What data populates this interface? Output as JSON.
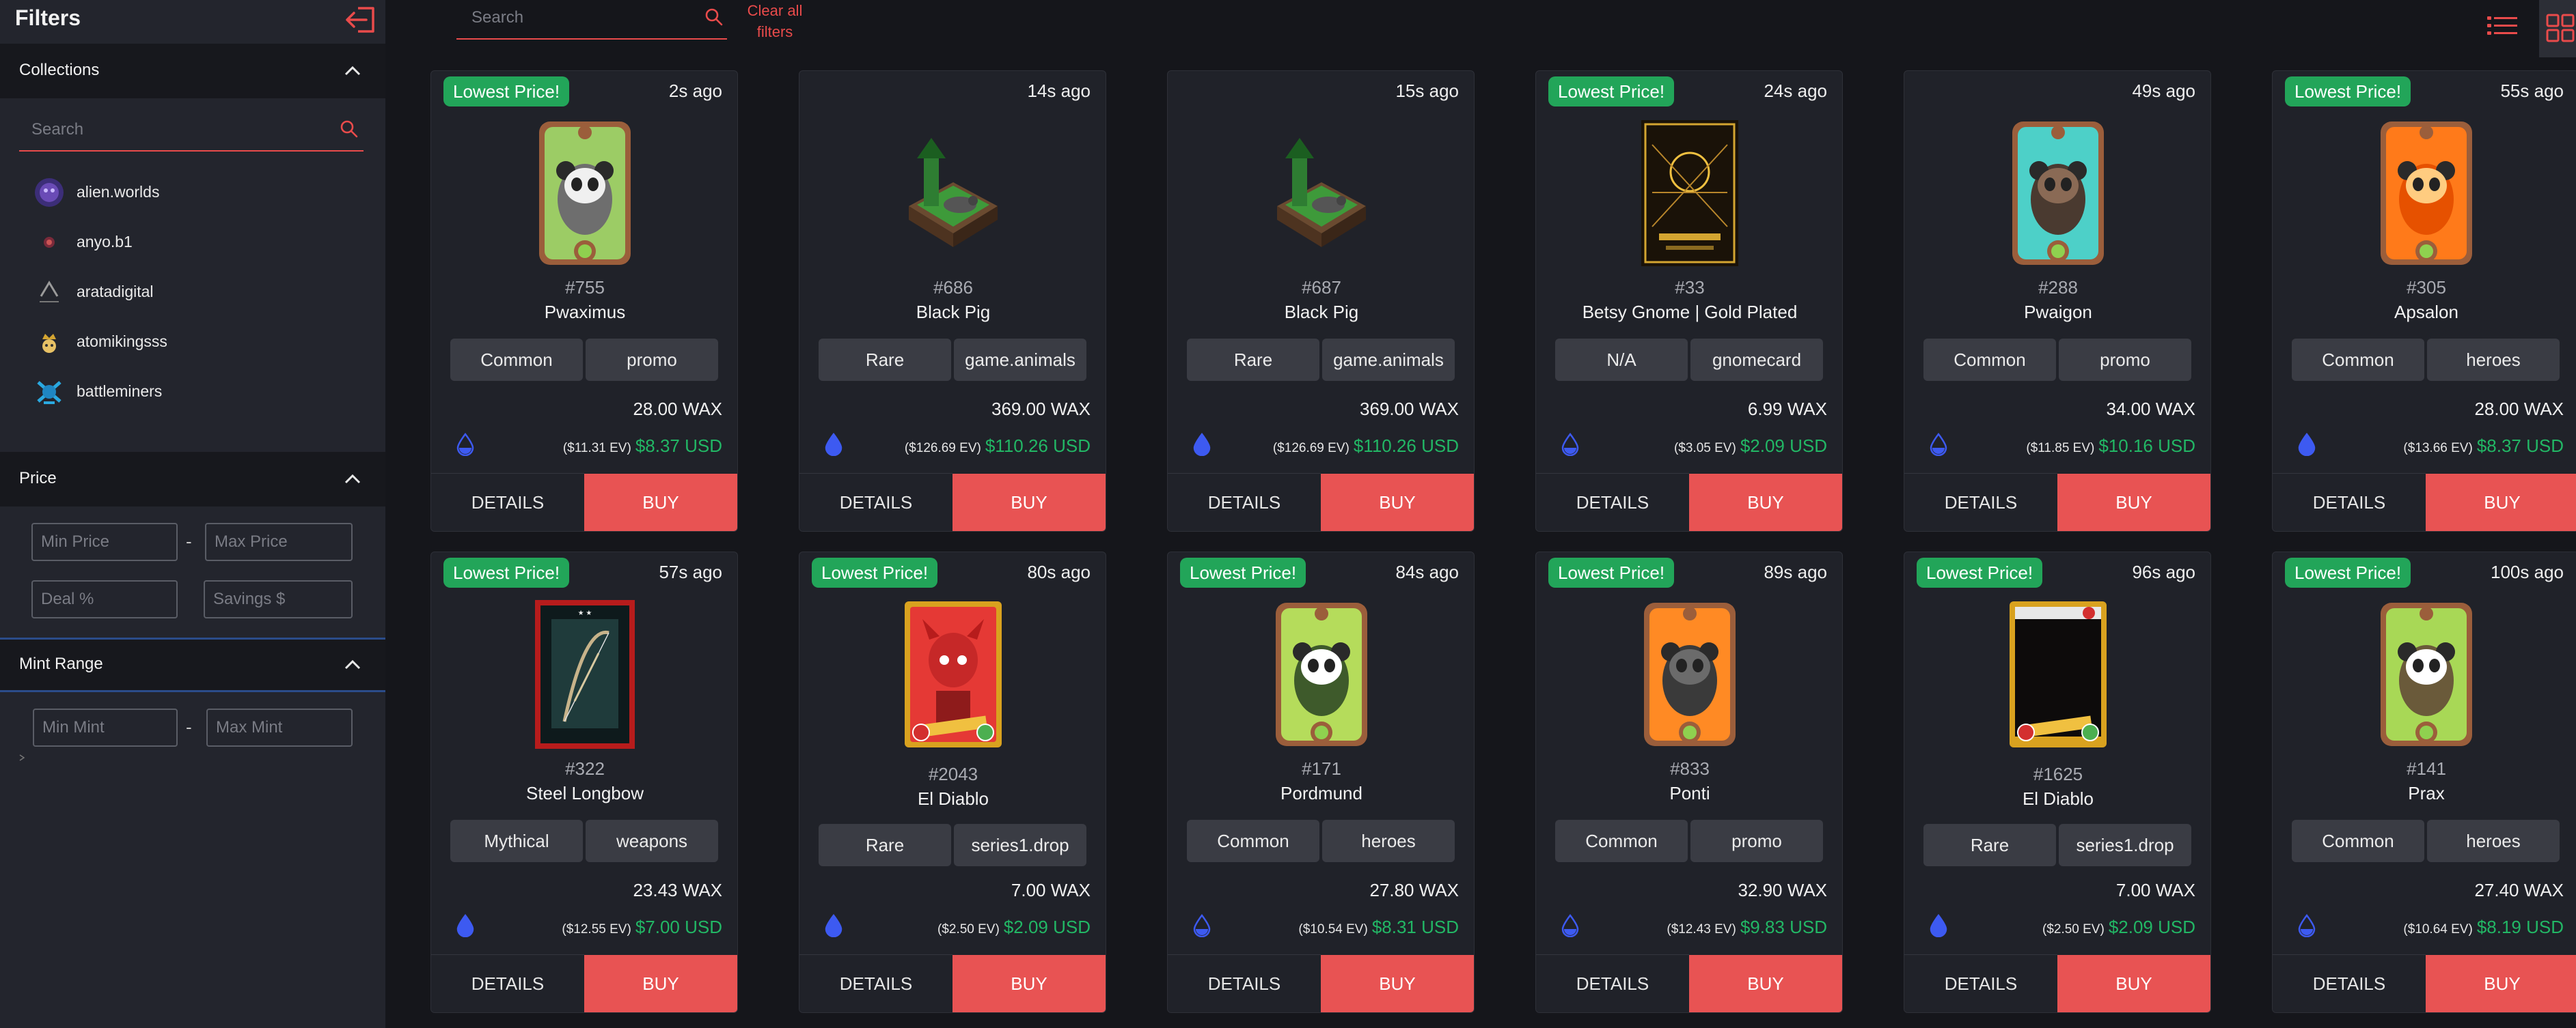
{
  "sidebar": {
    "title": "Filters",
    "collections_label": "Collections",
    "search_placeholder": "Search",
    "collections": [
      {
        "name": "alien.worlds",
        "color": "#6a4bb6"
      },
      {
        "name": "anyo.b1",
        "color": "#7a2a3a"
      },
      {
        "name": "aratadigital",
        "color": "#9a9a9a"
      },
      {
        "name": "atomikingsss",
        "color": "#d4a531"
      },
      {
        "name": "battleminers",
        "color": "#2aa9e0"
      }
    ],
    "price_label": "Price",
    "min_price_placeholder": "Min Price",
    "max_price_placeholder": "Max Price",
    "price_separator": "-",
    "deal_placeholder": "Deal %",
    "savings_placeholder": "Savings $",
    "mint_label": "Mint Range",
    "min_mint_placeholder": "Min Mint",
    "max_mint_placeholder": "Max Mint",
    "mint_separator": "-"
  },
  "topbar": {
    "search_placeholder": "Search",
    "clear_line1": "Clear all",
    "clear_line2": "filters"
  },
  "cards": [
    {
      "badge": "Lowest Price!",
      "ago": "2s ago",
      "mint": "#755",
      "name": "Pwaximus",
      "rarity": "Common",
      "schema": "promo",
      "wax": "28.00 WAX",
      "ev": "($11.31 EV)",
      "usd": "$8.37 USD",
      "art": "panda-green",
      "details": "DETAILS",
      "buy": "BUY"
    },
    {
      "badge": "",
      "ago": "14s ago",
      "mint": "#686",
      "name": "Black Pig",
      "rarity": "Rare",
      "schema": "game.animals",
      "wax": "369.00 WAX",
      "ev": "($126.69 EV)",
      "usd": "$110.26 USD",
      "art": "pigpen",
      "details": "DETAILS",
      "buy": "BUY"
    },
    {
      "badge": "",
      "ago": "15s ago",
      "mint": "#687",
      "name": "Black Pig",
      "rarity": "Rare",
      "schema": "game.animals",
      "wax": "369.00 WAX",
      "ev": "($126.69 EV)",
      "usd": "$110.26 USD",
      "art": "pigpen",
      "details": "DETAILS",
      "buy": "BUY"
    },
    {
      "badge": "Lowest Price!",
      "ago": "24s ago",
      "mint": "#33",
      "name": "Betsy Gnome | Gold Plated",
      "rarity": "N/A",
      "schema": "gnomecard",
      "wax": "6.99 WAX",
      "ev": "($3.05 EV)",
      "usd": "$2.09 USD",
      "art": "gold-card",
      "details": "DETAILS",
      "buy": "BUY"
    },
    {
      "badge": "",
      "ago": "49s ago",
      "mint": "#288",
      "name": "Pwaigon",
      "rarity": "Common",
      "schema": "promo",
      "wax": "34.00 WAX",
      "ev": "($11.85 EV)",
      "usd": "$10.16 USD",
      "art": "panda-teal",
      "details": "DETAILS",
      "buy": "BUY"
    },
    {
      "badge": "Lowest Price!",
      "ago": "55s ago",
      "mint": "#305",
      "name": "Apsalon",
      "rarity": "Common",
      "schema": "heroes",
      "wax": "28.00 WAX",
      "ev": "($13.66 EV)",
      "usd": "$8.37 USD",
      "art": "panda-orange",
      "details": "DETAILS",
      "buy": "BUY"
    },
    {
      "badge": "Lowest Price!",
      "ago": "57s ago",
      "mint": "#322",
      "name": "Steel Longbow",
      "rarity": "Mythical",
      "schema": "weapons",
      "wax": "23.43 WAX",
      "ev": "($12.55 EV)",
      "usd": "$7.00 USD",
      "art": "bow-card",
      "details": "DETAILS",
      "buy": "BUY"
    },
    {
      "badge": "Lowest Price!",
      "ago": "80s ago",
      "mint": "#2043",
      "name": "El Diablo",
      "rarity": "Rare",
      "schema": "series1.drop",
      "wax": "7.00 WAX",
      "ev": "($2.50 EV)",
      "usd": "$2.09 USD",
      "art": "diablo-red",
      "details": "DETAILS",
      "buy": "BUY"
    },
    {
      "badge": "Lowest Price!",
      "ago": "84s ago",
      "mint": "#171",
      "name": "Pordmund",
      "rarity": "Common",
      "schema": "heroes",
      "wax": "27.80 WAX",
      "ev": "($10.54 EV)",
      "usd": "$8.31 USD",
      "art": "panda-lime",
      "details": "DETAILS",
      "buy": "BUY"
    },
    {
      "badge": "Lowest Price!",
      "ago": "89s ago",
      "mint": "#833",
      "name": "Ponti",
      "rarity": "Common",
      "schema": "promo",
      "wax": "32.90 WAX",
      "ev": "($12.43 EV)",
      "usd": "$9.83 USD",
      "art": "panda-orange2",
      "details": "DETAILS",
      "buy": "BUY"
    },
    {
      "badge": "Lowest Price!",
      "ago": "96s ago",
      "mint": "#1625",
      "name": "El Diablo",
      "rarity": "Rare",
      "schema": "series1.drop",
      "wax": "7.00 WAX",
      "ev": "($2.50 EV)",
      "usd": "$2.09 USD",
      "art": "diablo-dark",
      "details": "DETAILS",
      "buy": "BUY"
    },
    {
      "badge": "Lowest Price!",
      "ago": "100s ago",
      "mint": "#141",
      "name": "Prax",
      "rarity": "Common",
      "schema": "heroes",
      "wax": "27.40 WAX",
      "ev": "($10.64 EV)",
      "usd": "$8.19 USD",
      "art": "panda-lime2",
      "details": "DETAILS",
      "buy": "BUY"
    }
  ],
  "colors": {
    "accent": "#e94b4b",
    "badge": "#22a559",
    "usd": "#22b765",
    "buy": "#e85353"
  }
}
